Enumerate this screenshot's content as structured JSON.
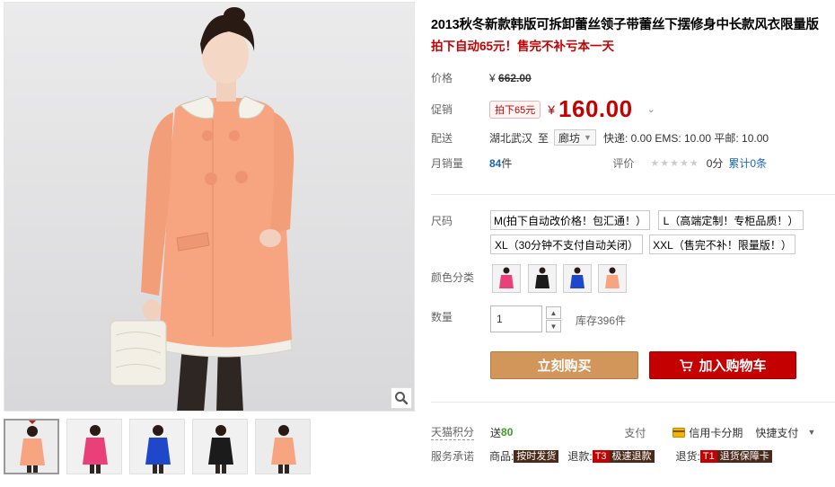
{
  "product": {
    "title": "2013秋冬新款韩版可拆卸蕾丝领子带蕾丝下摆修身中长款风衣限量版",
    "subtitle": "拍下自动65元！售完不补亏本一天"
  },
  "price": {
    "label": "价格",
    "currency": "¥",
    "original": "662.00"
  },
  "promo": {
    "label": "促销",
    "badge": "拍下65元",
    "currency": "¥",
    "price": "160.00",
    "chevron_icon": "chevron-down-icon"
  },
  "delivery": {
    "label": "配送",
    "from": "湖北武汉",
    "to_label": "至",
    "to_city": "廊坊",
    "shipping": "快递: 0.00 EMS: 10.00 平邮: 10.00"
  },
  "sales": {
    "label": "月销量",
    "count": "84",
    "unit": "件",
    "rating_label": "评价",
    "stars": "★★★★★",
    "score": "0分",
    "total": "累计0条"
  },
  "size": {
    "label": "尺码",
    "options": [
      "M(拍下自动改价格！包汇通！）",
      "L（高端定制！专柜品质！）",
      "XL（30分钟不支付自动关闭）",
      "XXL（售完不补！限量版！）"
    ]
  },
  "color": {
    "label": "颜色分类",
    "swatches": [
      "#e9407a",
      "#1b1b1b",
      "#1f47c9",
      "#f4a585"
    ]
  },
  "quantity": {
    "label": "数量",
    "value": "1",
    "stock": "库存396件"
  },
  "actions": {
    "buy_label": "立刻购买",
    "cart_label": "加入购物车",
    "cart_icon": "shopping-cart-icon"
  },
  "footer": {
    "points_label": "天猫积分",
    "points_prefix": "送",
    "points_value": "80",
    "pay_label": "支付",
    "credit": "信用卡分期",
    "quick_pay": "快捷支付",
    "service_label": "服务承诺",
    "goods_label": "商品:",
    "goods_tag": "按时发货",
    "refund_label": "退款:",
    "refund_code": "T3",
    "refund_tag": "极速退款",
    "return_label": "退货:",
    "return_code": "T1",
    "return_tag": "退货保障卡"
  },
  "colors": {
    "accent": "#c40000",
    "buy_button": "#d2965a",
    "coat": "#f6a580",
    "link": "#1a66b3"
  },
  "icons": {
    "zoom": "zoom-magnifier-icon",
    "credit_card": "credit-card-icon",
    "stepper_up": "caret-up-icon",
    "stepper_down": "caret-down-icon"
  }
}
